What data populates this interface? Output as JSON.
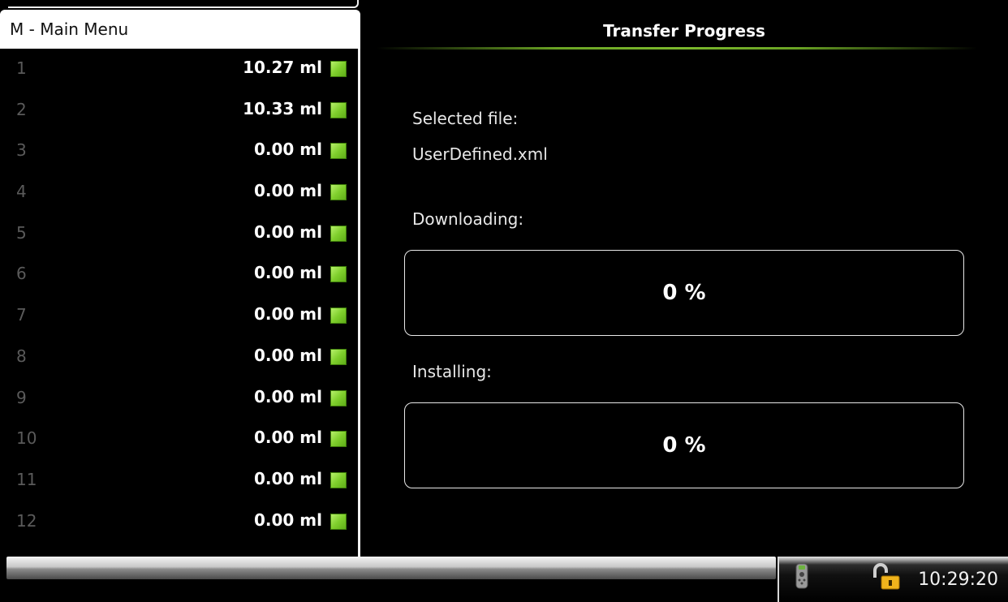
{
  "menu": {
    "title": "M - Main Menu"
  },
  "channels": [
    {
      "number": "1",
      "value": "10.27 ml",
      "status_color": "#7fcf2c"
    },
    {
      "number": "2",
      "value": "10.33 ml",
      "status_color": "#7fcf2c"
    },
    {
      "number": "3",
      "value": "0.00 ml",
      "status_color": "#7fcf2c"
    },
    {
      "number": "4",
      "value": "0.00 ml",
      "status_color": "#7fcf2c"
    },
    {
      "number": "5",
      "value": "0.00 ml",
      "status_color": "#7fcf2c"
    },
    {
      "number": "6",
      "value": "0.00 ml",
      "status_color": "#7fcf2c"
    },
    {
      "number": "7",
      "value": "0.00 ml",
      "status_color": "#7fcf2c"
    },
    {
      "number": "8",
      "value": "0.00 ml",
      "status_color": "#7fcf2c"
    },
    {
      "number": "9",
      "value": "0.00 ml",
      "status_color": "#7fcf2c"
    },
    {
      "number": "10",
      "value": "0.00 ml",
      "status_color": "#7fcf2c"
    },
    {
      "number": "11",
      "value": "0.00 ml",
      "status_color": "#7fcf2c"
    },
    {
      "number": "12",
      "value": "0.00 ml",
      "status_color": "#7fcf2c"
    }
  ],
  "transfer": {
    "title": "Transfer Progress",
    "selected_file_label": "Selected file:",
    "selected_file_name": "UserDefined.xml",
    "downloading_label": "Downloading:",
    "downloading_progress": "0 %",
    "downloading_fraction": 0,
    "installing_label": "Installing:",
    "installing_progress": "0 %",
    "installing_fraction": 0
  },
  "status_bar": {
    "remote_icon": "remote-control-icon",
    "lock_icon": "unlocked-padlock-icon",
    "clock": "10:29:20"
  },
  "colors": {
    "accent_green": "#7bb82c",
    "background": "#000000"
  }
}
